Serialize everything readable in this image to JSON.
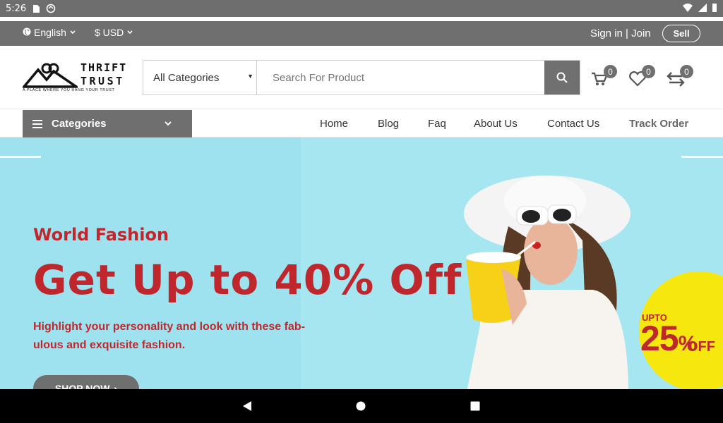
{
  "status_bar": {
    "time": "5:26"
  },
  "topbar": {
    "language": "English",
    "currency": "$ USD",
    "signin": "Sign in | Join",
    "sell": "Sell"
  },
  "logo": {
    "line1": "THRIFT",
    "line2": "TRUST",
    "tagline": "A PLACE WHERE YOU HANG YOUR TRUST"
  },
  "search": {
    "category": "All Categories",
    "placeholder": "Search For Product"
  },
  "header_icons": {
    "cart_count": "0",
    "wishlist_count": "0",
    "compare_count": "0"
  },
  "categories_label": "Categories",
  "nav": [
    "Home",
    "Blog",
    "Faq",
    "About Us",
    "Contact Us",
    "Track Order"
  ],
  "hero": {
    "subtitle": "World Fashion",
    "headline": "Get Up to 40% Off",
    "description": "Highlight your personality and look with these fab-ulous and exquisite fashion.",
    "cta": "SHOP NOW",
    "promo_upto": "UPTO",
    "promo_value": "25",
    "promo_pct": "%",
    "promo_off": "OFF"
  },
  "colors": {
    "accent": "#c0272d",
    "gray": "#6f6f6f",
    "hero_bg": "#9ee2ef",
    "promo": "#f6e80e"
  }
}
